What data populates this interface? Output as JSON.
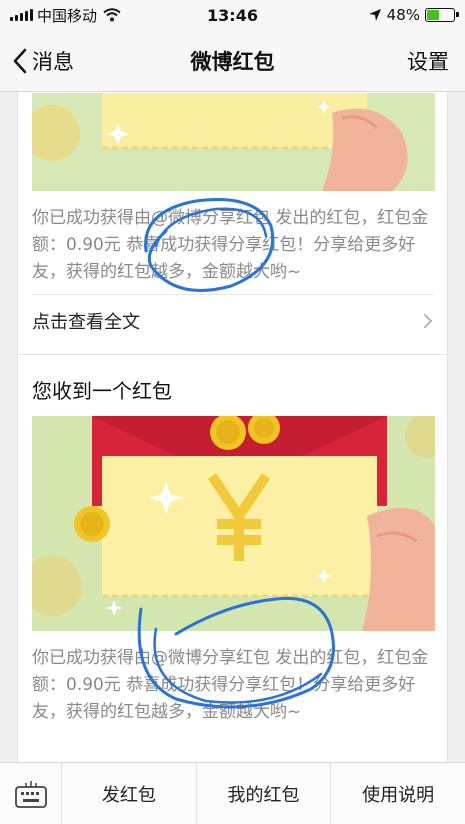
{
  "status_bar": {
    "carrier": "中国移动",
    "time": "13:46",
    "battery": "48%",
    "battery_level": 0.48
  },
  "nav": {
    "back_label": "消息",
    "title": "微博红包",
    "settings_label": "设置"
  },
  "cards": [
    {
      "title": "",
      "body": "你已成功获得由@微博分享红包 发出的红包，红包金额：0.90元 恭喜成功获得分享红包！分享给更多好友，获得的红包越多，金额越大哟~",
      "read_more": "点击查看全文"
    },
    {
      "title": "您收到一个红包",
      "body": "你已成功获得由@微博分享红包 发出的红包，红包金额：0.90元 恭喜成功获得分享红包！分享给更多好友，获得的红包越多，金额越大哟~",
      "banner_symbol": "¥"
    }
  ],
  "tab_bar": {
    "items": [
      {
        "label": "发红包"
      },
      {
        "label": "我的红包"
      },
      {
        "label": "使用说明"
      }
    ]
  },
  "colors": {
    "envelope_red": "#d8243a",
    "envelope_cream": "#fbf0a3",
    "banner_green": "#cfe3a8",
    "coin_gold": "#f0c020",
    "ink_blue": "#2a73d8"
  }
}
